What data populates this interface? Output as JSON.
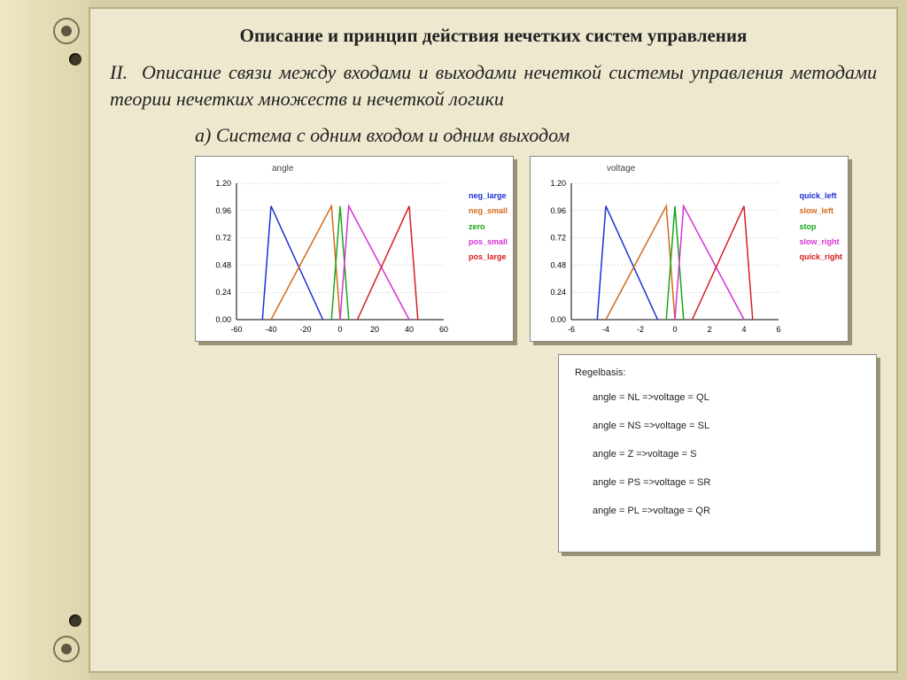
{
  "title": "Описание и принцип действия нечетких систем управления",
  "subtitle_num": "II.",
  "subtitle": "Описание связи между входами и выходами нечеткой системы управления методами теории нечетких множеств и нечеткой логики",
  "section_a": "а) Система с одним входом и одним выходом",
  "rules_header": "Regelbasis:",
  "rules": [
    "angle = NL  =>voltage = QL",
    "angle = NS  =>voltage = SL",
    "angle = Z    =>voltage = S",
    "angle = PS  =>voltage = SR",
    "angle = PL  =>voltage = QR"
  ],
  "chart_data": [
    {
      "type": "line",
      "title": "angle",
      "xlabel": "",
      "ylabel": "",
      "xlim": [
        -60,
        60
      ],
      "ylim": [
        0,
        1.2
      ],
      "xticks": [
        -60,
        -40,
        -20,
        0,
        20,
        40,
        60
      ],
      "yticks": [
        0.0,
        0.24,
        0.48,
        0.72,
        0.96,
        1.2
      ],
      "series": [
        {
          "name": "neg_large",
          "color": "#1a2fd6",
          "x": [
            -45,
            -40,
            -10
          ],
          "y": [
            0,
            1,
            0
          ]
        },
        {
          "name": "neg_small",
          "color": "#d46a1a",
          "x": [
            -40,
            -5,
            0
          ],
          "y": [
            0,
            1,
            0
          ]
        },
        {
          "name": "zero",
          "color": "#18a61a",
          "x": [
            -5,
            0,
            5
          ],
          "y": [
            0,
            1,
            0
          ]
        },
        {
          "name": "pos_small",
          "color": "#d532d5",
          "x": [
            0,
            5,
            40
          ],
          "y": [
            0,
            1,
            0
          ]
        },
        {
          "name": "pos_large",
          "color": "#d81c1c",
          "x": [
            10,
            40,
            45
          ],
          "y": [
            0,
            1,
            0
          ]
        }
      ],
      "legend": [
        "neg_large",
        "neg_small",
        "zero",
        "pos_small",
        "pos_large"
      ]
    },
    {
      "type": "line",
      "title": "voltage",
      "xlabel": "",
      "ylabel": "",
      "xlim": [
        -6,
        6
      ],
      "ylim": [
        0,
        1.2
      ],
      "xticks": [
        -6,
        -4,
        -2,
        0,
        2,
        4,
        6
      ],
      "yticks": [
        0.0,
        0.24,
        0.48,
        0.72,
        0.96,
        1.2
      ],
      "series": [
        {
          "name": "quick_left",
          "color": "#1a2fd6",
          "x": [
            -4.5,
            -4,
            -1
          ],
          "y": [
            0,
            1,
            0
          ]
        },
        {
          "name": "slow_left",
          "color": "#d46a1a",
          "x": [
            -4,
            -0.5,
            0
          ],
          "y": [
            0,
            1,
            0
          ]
        },
        {
          "name": "stop",
          "color": "#18a61a",
          "x": [
            -0.5,
            0,
            0.5
          ],
          "y": [
            0,
            1,
            0
          ]
        },
        {
          "name": "slow_right",
          "color": "#d532d5",
          "x": [
            0,
            0.5,
            4
          ],
          "y": [
            0,
            1,
            0
          ]
        },
        {
          "name": "quick_right",
          "color": "#d81c1c",
          "x": [
            1,
            4,
            4.5
          ],
          "y": [
            0,
            1,
            0
          ]
        }
      ],
      "legend": [
        "quick_left",
        "slow_left",
        "stop",
        "slow_right",
        "quick_right"
      ]
    }
  ]
}
